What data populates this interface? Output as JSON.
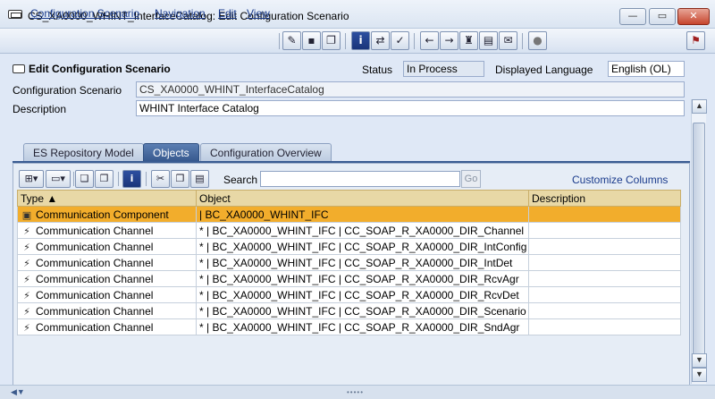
{
  "window": {
    "title": "CS_XA0000_WHINT_InterfaceCatalog: Edit Configuration Scenario",
    "minimize_glyph": "—",
    "maximize_glyph": "▭",
    "close_glyph": "✕"
  },
  "menu": {
    "items": [
      "Configuration Scenario",
      "Navigation",
      "Edit",
      "View"
    ]
  },
  "toolbar": {
    "icons": [
      "pencil-glasses-icon",
      "save-icon",
      "copy-icon",
      "info-icon",
      "navigate-icon",
      "check-icon",
      "back-icon",
      "forward-icon",
      "hat-icon",
      "list-icon",
      "scroll-icon",
      "circle-icon",
      "pin-icon"
    ],
    "glyphs": [
      "✎",
      "▪",
      "❐",
      "i",
      "⇄",
      "✓",
      "←",
      "→",
      "♜",
      "▤",
      "✉",
      "●",
      "⚑"
    ]
  },
  "header": {
    "section_title": "Edit Configuration Scenario",
    "status_label": "Status",
    "status_value": "In Process",
    "language_label": "Displayed Language",
    "language_value": "English (OL)",
    "scenario_label": "Configuration Scenario",
    "scenario_value": "CS_XA0000_WHINT_InterfaceCatalog",
    "description_label": "Description",
    "description_value": "WHINT Interface Catalog"
  },
  "tabs": [
    {
      "label": "ES Repository Model",
      "active": false
    },
    {
      "label": "Objects",
      "active": true
    },
    {
      "label": "Configuration Overview",
      "active": false
    }
  ],
  "panel": {
    "search_label": "Search",
    "go_label": "Go",
    "customize_label": "Customize Columns"
  },
  "table": {
    "columns": [
      "Type ▲",
      "Object",
      "Description"
    ],
    "rows": [
      {
        "type": "Communication Component",
        "object": "| BC_XA0000_WHINT_IFC",
        "description": "",
        "icon": "component-icon",
        "selected": true
      },
      {
        "type": "Communication Channel",
        "object": "* | BC_XA0000_WHINT_IFC | CC_SOAP_R_XA0000_DIR_Channel",
        "description": "",
        "icon": "channel-icon",
        "selected": false
      },
      {
        "type": "Communication Channel",
        "object": "* | BC_XA0000_WHINT_IFC | CC_SOAP_R_XA0000_DIR_IntConfig",
        "description": "",
        "icon": "channel-icon",
        "selected": false
      },
      {
        "type": "Communication Channel",
        "object": "* | BC_XA0000_WHINT_IFC | CC_SOAP_R_XA0000_DIR_IntDet",
        "description": "",
        "icon": "channel-icon",
        "selected": false
      },
      {
        "type": "Communication Channel",
        "object": "* | BC_XA0000_WHINT_IFC | CC_SOAP_R_XA0000_DIR_RcvAgr",
        "description": "",
        "icon": "channel-icon",
        "selected": false
      },
      {
        "type": "Communication Channel",
        "object": "* | BC_XA0000_WHINT_IFC | CC_SOAP_R_XA0000_DIR_RcvDet",
        "description": "",
        "icon": "channel-icon",
        "selected": false
      },
      {
        "type": "Communication Channel",
        "object": "* | BC_XA0000_WHINT_IFC | CC_SOAP_R_XA0000_DIR_Scenario",
        "description": "",
        "icon": "channel-icon",
        "selected": false
      },
      {
        "type": "Communication Channel",
        "object": "* | BC_XA0000_WHINT_IFC | CC_SOAP_R_XA0000_DIR_SndAgr",
        "description": "",
        "icon": "channel-icon",
        "selected": false
      }
    ]
  },
  "colors": {
    "selected_row": "#f2ad2c",
    "header_row": "#e8d8a6",
    "active_tab": "#35578c",
    "link": "#1a3b8c"
  }
}
